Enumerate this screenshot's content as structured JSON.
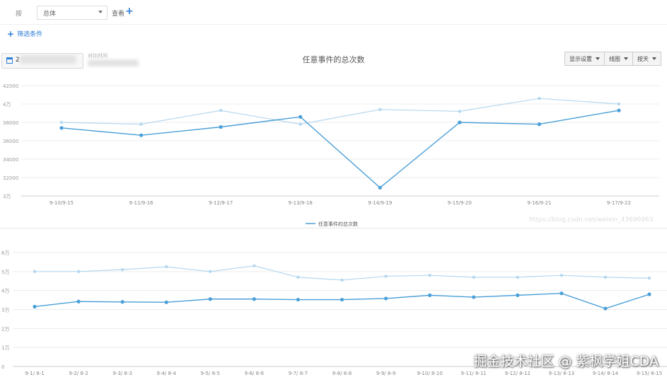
{
  "filter": {
    "prefix": "按",
    "dimension": "总体",
    "view_label": "查看",
    "add_filter": "筛选条件"
  },
  "date_range": {
    "value": "2",
    "compare_label": "对比时间"
  },
  "toolbar": {
    "display_settings": "显示设置",
    "chart_type": "线图",
    "granularity": "按天"
  },
  "chart_data": [
    {
      "type": "line",
      "title": "任意事件的总次数",
      "categories": [
        "9-10/9-15",
        "9-11/9-16",
        "9-12/9-17",
        "9-13/9-18",
        "9-14/9-19",
        "9-15/9-20",
        "9-16/9-21",
        "9-17/9-22"
      ],
      "series": [
        {
          "name": "任意事件的总次数",
          "values": [
            37400,
            36600,
            37500,
            38600,
            30900,
            38000,
            37800,
            39300
          ]
        },
        {
          "values": [
            38000,
            37800,
            39300,
            37800,
            39400,
            39200,
            40600,
            40000
          ]
        }
      ],
      "ylim": [
        30000,
        42000
      ],
      "yticks": [
        "42000",
        "4万",
        "38000",
        "36000",
        "34000",
        "32000",
        "3万"
      ],
      "legend_position": "bottom"
    },
    {
      "type": "line",
      "categories": [
        "9-1/ 8-1",
        "9-2/ 8-2",
        "9-3/ 8-3",
        "9-4/ 8-4",
        "9-5/ 8-5",
        "9-6/ 8-6",
        "9-7/ 8-7",
        "9-8/ 8-8",
        "9-9/ 8-9",
        "9-10/ 8-10",
        "9-11/ 8-11",
        "9-12/ 8-12",
        "9-13/ 8-13",
        "9-14/ 8-14",
        "9-15/ 8-15"
      ],
      "series": [
        {
          "values": [
            31500,
            34200,
            34000,
            33800,
            35500,
            35500,
            35200,
            35200,
            35800,
            37500,
            36500,
            37500,
            38500,
            30500,
            38000
          ]
        },
        {
          "values": [
            50000,
            50000,
            51000,
            52500,
            50000,
            53000,
            47000,
            45500,
            47500,
            48000,
            47000,
            47000,
            48000,
            47000,
            46500
          ]
        }
      ],
      "ylim": [
        0,
        60000
      ],
      "yticks": [
        "6万",
        "5万",
        "4万",
        "3万",
        "2万",
        "1万",
        "0"
      ]
    }
  ],
  "watermark": "掘金技术社区 @ 紫枫学姐CDA",
  "csdn_mark": "https://blog.csdn.net/weixin_43696963"
}
